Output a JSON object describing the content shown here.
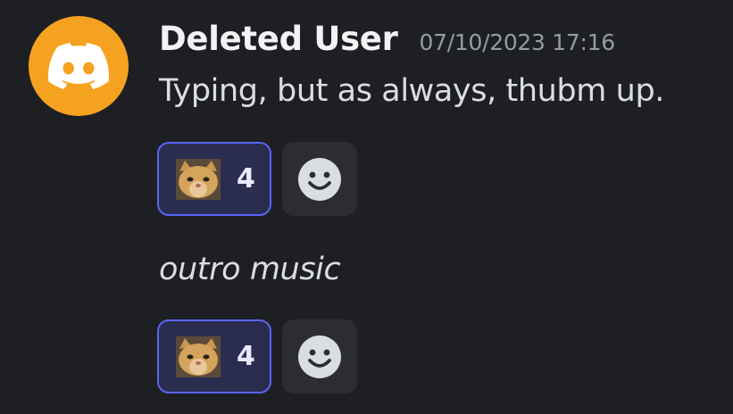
{
  "message": {
    "avatar_icon": "discord-logo-icon",
    "username": "Deleted User",
    "timestamp": "07/10/2023 17:16",
    "text": "Typing, but as always, thubm up.",
    "reactions": [
      {
        "emoji_icon": "cat-face-emoji-icon",
        "count": "4",
        "selected": true
      }
    ],
    "add_reaction_icon": "smile-icon"
  },
  "followup_message": {
    "text": "outro music",
    "reactions": [
      {
        "emoji_icon": "cat-face-emoji-icon",
        "count": "4",
        "selected": true
      }
    ],
    "add_reaction_icon": "smile-icon"
  },
  "colors": {
    "background": "#1e1f22",
    "avatar": "#f6a221",
    "reaction_selected_bg": "#2a2d4f",
    "reaction_selected_border": "#5865f2",
    "username": "#f2f3f5",
    "timestamp": "#949ba4",
    "text": "#dbdee1"
  }
}
